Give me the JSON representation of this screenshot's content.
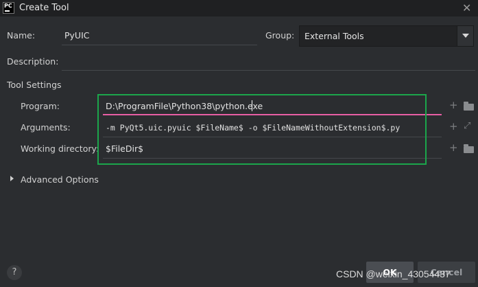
{
  "window": {
    "title": "Create Tool",
    "app_icon_text": "PC"
  },
  "form": {
    "name_label": "Name:",
    "name_value": "PyUIC",
    "group_label": "Group:",
    "group_value": "External Tools",
    "description_label": "Description:",
    "description_value": ""
  },
  "tool_settings": {
    "heading": "Tool Settings",
    "program_label": "Program:",
    "program_value": "D:\\ProgramFile\\Python38\\python.exe",
    "arguments_label": "Arguments:",
    "arguments_value": "-m PyQt5.uic.pyuic  $FileName$ -o $FileNameWithoutExtension$.py",
    "working_dir_label": "Working directory:",
    "working_dir_value": "$FileDir$"
  },
  "advanced": {
    "label": "Advanced Options"
  },
  "footer": {
    "help_label": "?",
    "ok_label": "OK",
    "cancel_label": "Cancel",
    "watermark": "CSDN @weixin_43054437"
  },
  "colors": {
    "background": "#2b2d30",
    "highlight_box": "#1ba64b",
    "focus_underline": "#e85ea4"
  }
}
